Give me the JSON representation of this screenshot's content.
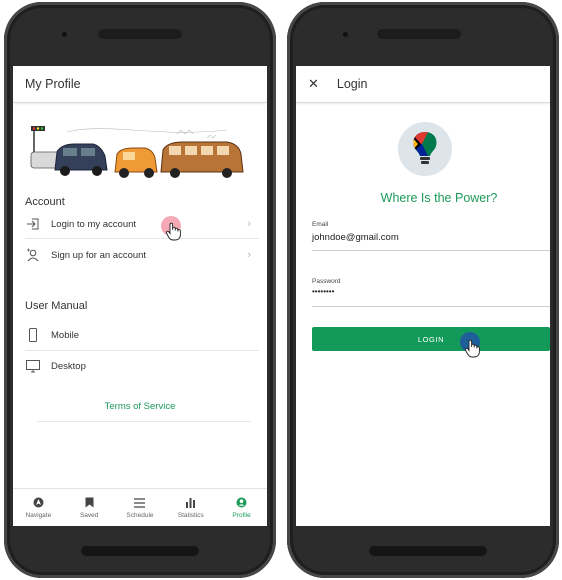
{
  "left_screen": {
    "header_title": "My Profile",
    "account_label": "Account",
    "login_row": "Login to my account",
    "signup_row": "Sign up for an account",
    "manual_label": "User Manual",
    "mobile_row": "Mobile",
    "desktop_row": "Desktop",
    "terms_link": "Terms of Service",
    "nav": [
      {
        "label": "Navigate",
        "icon": "navigate-icon"
      },
      {
        "label": "Saved",
        "icon": "bookmark-icon"
      },
      {
        "label": "Schedule",
        "icon": "list-icon"
      },
      {
        "label": "Statistics",
        "icon": "bar-chart-icon"
      },
      {
        "label": "Profile",
        "icon": "profile-icon",
        "active": true
      }
    ]
  },
  "right_screen": {
    "header_title": "Login",
    "close_icon": "close-icon",
    "app_name": "Where Is the Power?",
    "email_label": "Email",
    "email_value": "johndoe@gmail.com",
    "password_label": "Password",
    "password_value": "••••••••",
    "login_button": "LOGIN"
  },
  "colors": {
    "accent_green": "#1e9a5a",
    "touch_pink": "#f4a9b4",
    "touch_blue": "#1e5f9a"
  }
}
